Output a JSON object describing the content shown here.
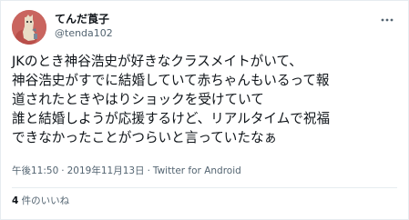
{
  "author": {
    "display_name": "てんだ莨子",
    "handle": "@tenda102",
    "avatar_icon": "avatar-illustration-icon",
    "avatar_color": "#c9655f"
  },
  "menu": {
    "icon": "more-options-icon"
  },
  "tweet": {
    "lines": [
      "JKのとき神谷浩史が好きなクラスメイトがいて、",
      "神谷浩史がすでに結婚していて赤ちゃんもいるって報",
      "道されたときやはりショックを受けていて",
      "誰と結婚しようが応援するけど、リアルタイムで祝福",
      "できなかったことがつらいと言っていたなぁ"
    ]
  },
  "meta": {
    "time": "午後11:50",
    "separator": "·",
    "date": "2019年11月13日",
    "source": "Twitter for Android"
  },
  "likes": {
    "count": "4",
    "label": " 件のいいね"
  },
  "colors": {
    "text": "#0f1419",
    "secondary": "#536471",
    "border": "#e6ecf0"
  }
}
